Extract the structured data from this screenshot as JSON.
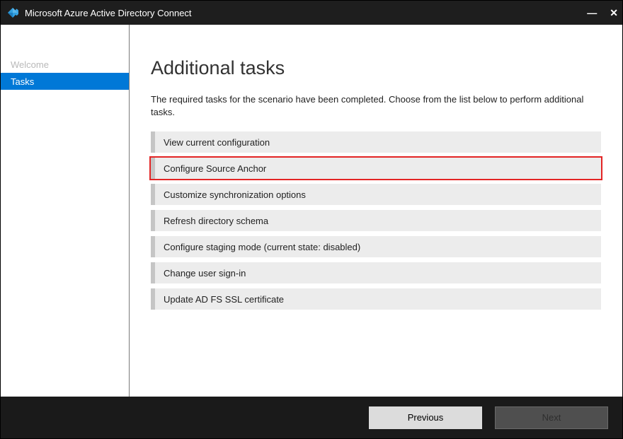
{
  "titlebar": {
    "title": "Microsoft Azure Active Directory Connect"
  },
  "sidebar": {
    "items": [
      {
        "label": "Welcome",
        "active": false
      },
      {
        "label": "Tasks",
        "active": true
      }
    ]
  },
  "main": {
    "heading": "Additional tasks",
    "description": "The required tasks for the scenario have been completed. Choose from the list below to perform additional tasks.",
    "tasks": [
      {
        "label": "View current configuration",
        "highlight": false
      },
      {
        "label": "Configure Source Anchor",
        "highlight": true
      },
      {
        "label": "Customize synchronization options",
        "highlight": false
      },
      {
        "label": "Refresh directory schema",
        "highlight": false
      },
      {
        "label": "Configure staging mode (current state: disabled)",
        "highlight": false
      },
      {
        "label": "Change user sign-in",
        "highlight": false
      },
      {
        "label": "Update AD FS SSL certificate",
        "highlight": false
      }
    ]
  },
  "footer": {
    "previous": "Previous",
    "next": "Next"
  }
}
